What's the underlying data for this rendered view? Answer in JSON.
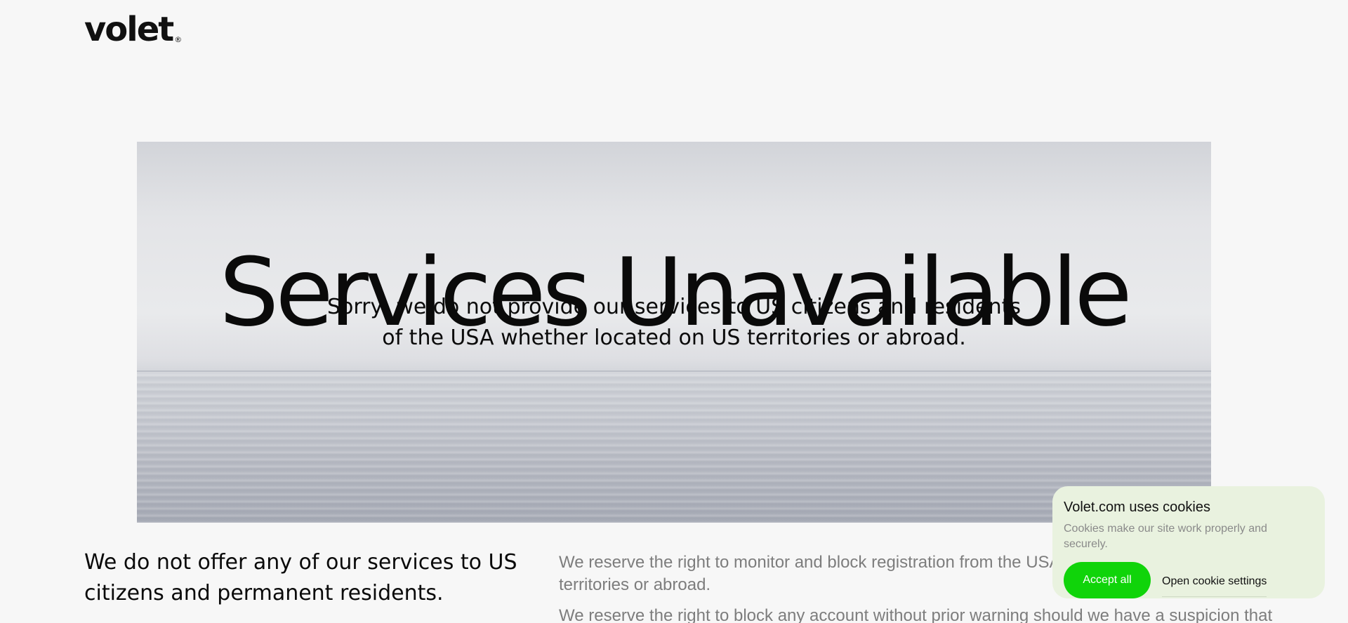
{
  "header": {
    "logo_text": "volet",
    "logo_mark": "®"
  },
  "hero": {
    "title": "Services Unavailable",
    "subtitle_line1": "Sorry, we do not provide our services to US citizens and residents",
    "subtitle_line2": "of the USA whether located on US territories or abroad."
  },
  "content": {
    "heading": "We do not offer any of our services to US citizens and permanent residents.",
    "paragraphs": [
      "We reserve the right to monitor and block registration from the USA residents located on US territories or abroad.",
      "We reserve the right to block any account without prior warning should we have a suspicion that"
    ]
  },
  "cookie_banner": {
    "title": "Volet.com uses cookies",
    "description": "Cookies make our site work properly and securely.",
    "accept_label": "Accept all",
    "settings_label": "Open cookie settings",
    "accent_color": "#10d40a",
    "background_color": "#e9f2df"
  }
}
